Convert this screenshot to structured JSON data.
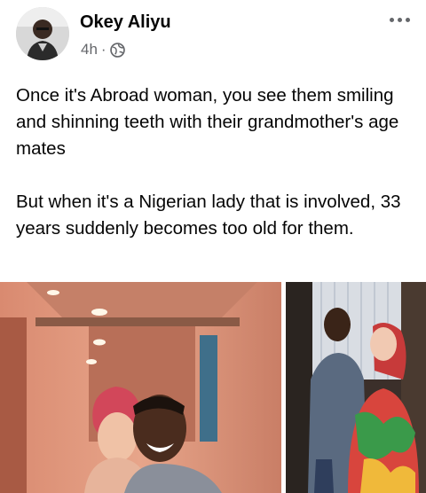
{
  "post": {
    "author": "Okey Aliyu",
    "time": "4h",
    "separator": "·",
    "privacy_icon": "globe-icon",
    "more_icon": "more-options-icon",
    "paragraphs": [
      "Once it's Abroad woman, you see them smiling and shinning teeth with their grandmother's age mates",
      "But when it's a Nigerian lady that is involved, 33 years suddenly becomes too old for them."
    ],
    "photos": [
      {
        "subject": "couple-selfie-hallway"
      },
      {
        "subject": "couple-embrace-lights"
      }
    ]
  },
  "colors": {
    "text": "#050505",
    "secondary": "#65676b",
    "background": "#ffffff"
  }
}
